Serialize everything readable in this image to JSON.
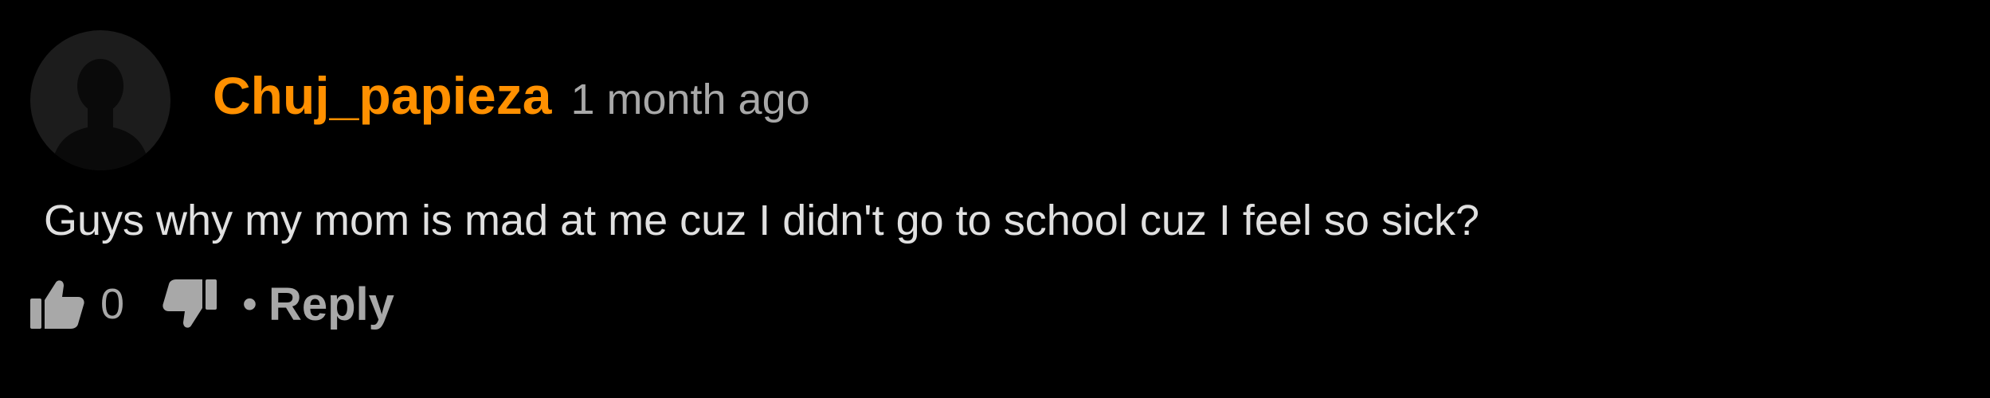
{
  "comment": {
    "username": "Chuj_papieza",
    "timestamp": "1 month ago",
    "text": "Guys why my mom is mad at me cuz I didn't go to school cuz I feel so sick?",
    "like_count": "0",
    "reply_label": "Reply",
    "separator": "•",
    "avatar_icon": "default-user-silhouette-icon",
    "like_icon": "thumbs-up-icon",
    "dislike_icon": "thumbs-down-icon"
  },
  "colors": {
    "background": "#000000",
    "username": "#ff9000",
    "body_text": "#e0e0e0",
    "muted_text": "#a8a8a8",
    "avatar_bg": "#1c1c1c",
    "avatar_silhouette": "#0a0a0a"
  }
}
